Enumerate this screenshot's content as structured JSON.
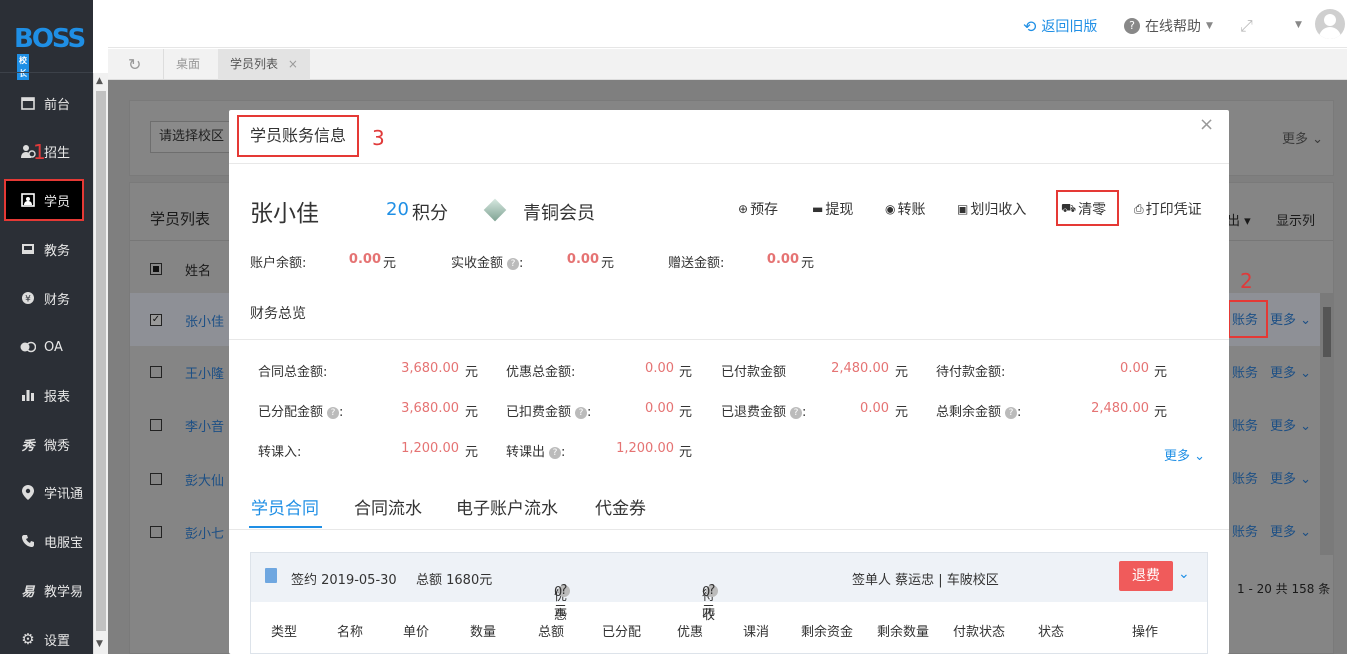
{
  "app": {
    "logo": "BOSS",
    "logo_badge": "校长"
  },
  "sidebar": {
    "items": [
      {
        "label": "前台",
        "icon": "calendar-icon"
      },
      {
        "label": "招生",
        "icon": "user-plus-icon"
      },
      {
        "label": "学员",
        "icon": "student-icon",
        "active": true
      },
      {
        "label": "教务",
        "icon": "book-icon"
      },
      {
        "label": "财务",
        "icon": "yen-icon"
      },
      {
        "label": "OA",
        "icon": "oa-icon"
      },
      {
        "label": "报表",
        "icon": "chart-icon"
      },
      {
        "label": "微秀",
        "icon": "weixiu-icon"
      },
      {
        "label": "学讯通",
        "icon": "location-icon"
      },
      {
        "label": "电服宝",
        "icon": "phone-icon"
      },
      {
        "label": "教学易",
        "icon": "teach-icon"
      },
      {
        "label": "设置",
        "icon": "gear-icon"
      }
    ]
  },
  "annotations": {
    "a1": "1",
    "a2": "2",
    "a3": "3"
  },
  "topbar": {
    "back_old": "返回旧版",
    "help": "在线帮助"
  },
  "tabs": {
    "home": "桌面",
    "students": "学员列表",
    "close": "×"
  },
  "background": {
    "campus_select": "请选择校区",
    "more": "更多",
    "list_title": "学员列表",
    "export_suffix": "出",
    "display_cols": "显示列",
    "name_header": "姓名",
    "rows": [
      {
        "name": "张小佳",
        "checked": true
      },
      {
        "name": "王小隆",
        "checked": false
      },
      {
        "name": "李小音",
        "checked": false
      },
      {
        "name": "彭大仙",
        "checked": false
      },
      {
        "name": "彭小七",
        "checked": false
      }
    ],
    "row_action": "账务",
    "row_more": "更多",
    "pagination": "1 - 20  共 158 条"
  },
  "modal": {
    "title": "学员账务信息",
    "close": "×",
    "student_name": "张小佳",
    "points_value": "20",
    "points_label": "积分",
    "member_level": "青铜会员",
    "actions": {
      "deposit": "预存",
      "withdraw": "提现",
      "transfer": "转账",
      "allocate": "划归收入",
      "clear": "清零",
      "print": "打印凭证"
    },
    "balance": {
      "account_label": "账户余额:",
      "account_value": "0.00",
      "unit": "元",
      "received_label": "实收金额",
      "received_value": "0.00",
      "gift_label": "赠送金额:",
      "gift_value": "0.00"
    },
    "overview_title": "财务总览",
    "overview": [
      {
        "label": "合同总金额:",
        "value": "3,680.00"
      },
      {
        "label": "优惠总金额:",
        "value": "0.00"
      },
      {
        "label": "已付款金额",
        "value": "2,480.00"
      },
      {
        "label": "待付款金额:",
        "value": "0.00"
      },
      {
        "label": "已分配金额",
        "value": "3,680.00"
      },
      {
        "label": "已扣费金额",
        "value": "0.00"
      },
      {
        "label": "已退费金额",
        "value": "0.00"
      },
      {
        "label": "总剩余金额",
        "value": "2,480.00"
      },
      {
        "label": "转课入:",
        "value": "1,200.00"
      },
      {
        "label": "转课出",
        "value": "1,200.00"
      }
    ],
    "overview_unit": "元",
    "overview_more": "更多",
    "tabs": [
      "学员合同",
      "合同流水",
      "电子账户流水",
      "代金券"
    ],
    "contract": {
      "signed": "签约 2019-05-30",
      "total": "总额 1680元",
      "discount_label": "优惠",
      "discount_value": "0元",
      "pending_label": "待收",
      "pending_value": "0元",
      "signer": "签单人 蔡运忠 | 车陂校区",
      "refund": "退费",
      "columns": [
        "类型",
        "名称",
        "单价",
        "数量",
        "总额",
        "已分配",
        "优惠",
        "课消",
        "剩余资金",
        "剩余数量",
        "付款状态",
        "状态",
        "操作"
      ]
    }
  }
}
